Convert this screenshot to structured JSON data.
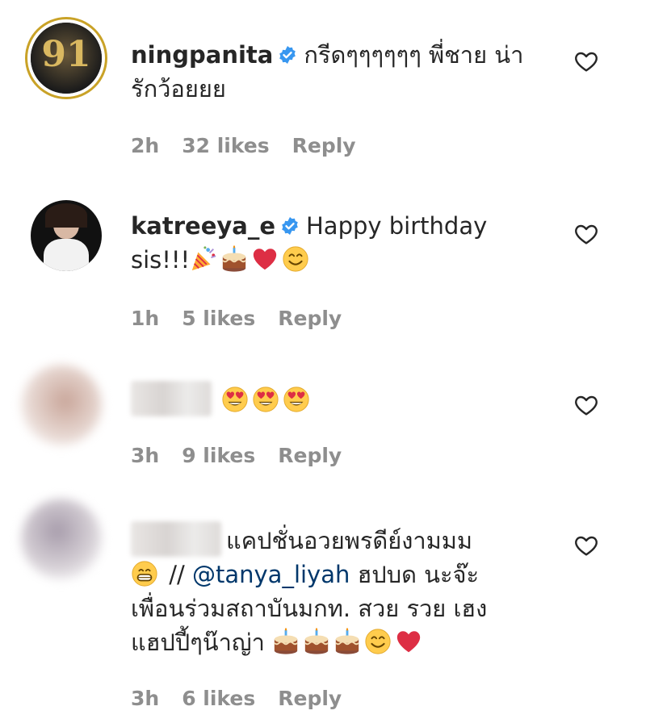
{
  "comments": [
    {
      "username": "ningpanita",
      "text_line1": "กรีดๆๆๆๆๆๆ พี่ชาย น่า",
      "text_line2": "รักว้อยยย",
      "time": "2h",
      "likes": "32 likes",
      "reply": "Reply",
      "avatar_text": "91"
    },
    {
      "username": "katreeya_e",
      "text_line1": "Happy birthday",
      "text_line2": "sis!!!",
      "time": "1h",
      "likes": "5 likes",
      "reply": "Reply"
    },
    {
      "time": "3h",
      "likes": "9 likes",
      "reply": "Reply"
    },
    {
      "text_line1": "แคปชั่นอวยพรดีย์งามมม",
      "text_line2_pre": " // ",
      "mention": "@tanya_liyah",
      "text_line2_post": " ฮปบด นะจ๊ะ",
      "text_line3": "เพื่อนร่วมสถาบันมกท. สวย รวย เฮง",
      "text_line4": "แฮปปี้ๆน๊าญ่า",
      "time": "3h",
      "likes": "6 likes",
      "reply": "Reply"
    }
  ],
  "colors": {
    "text": "#262626",
    "meta": "#8e8e8e",
    "verified": "#3897f0",
    "mention": "#00376b"
  }
}
